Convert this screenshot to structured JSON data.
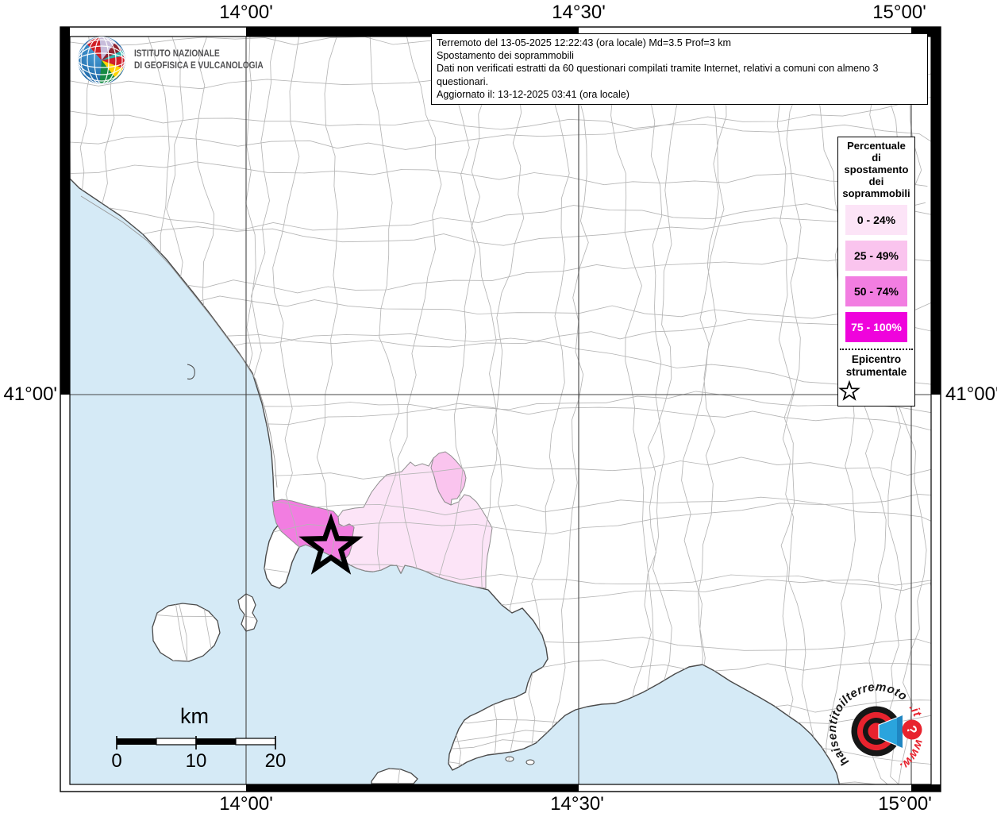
{
  "map_meta": {
    "coords_top": [
      "14°00'",
      "14°30'",
      "15°00'"
    ],
    "coords_bottom": [
      "14°00'",
      "14°30'",
      "15°00'"
    ],
    "coord_left": "41°00'",
    "coord_right": "41°00'"
  },
  "branding": {
    "org_line1": "ISTITUTO NAZIONALE",
    "org_line2": "DI GEOFISICA E VULCANOLOGIA"
  },
  "info_box": {
    "line1": "Terremoto del 13-05-2025 12:22:43 (ora locale) Md=3.5 Prof=3 km",
    "line2": "Spostamento dei soprammobili",
    "line3": "Dati non verificati estratti da 60 questionari compilati tramite Internet, relativi a comuni con almeno 3 questionari.",
    "line4": "Aggiornato il: 13-12-2025 03:41 (ora locale)"
  },
  "legend": {
    "title_line1": "Percentuale",
    "title_line2": "di",
    "title_line3": "spostamento",
    "title_line4": "dei",
    "title_line5": "soprammobili",
    "classes": [
      {
        "label": "0 - 24%",
        "color": "#fce4f7",
        "text": "#000000"
      },
      {
        "label": "25 - 49%",
        "color": "#fac4ee",
        "text": "#000000"
      },
      {
        "label": "50 - 74%",
        "color": "#f27de1",
        "text": "#000000"
      },
      {
        "label": "75 - 100%",
        "color": "#ef03dc",
        "text": "#ffffff"
      }
    ],
    "epicenter_line1": "Epicentro",
    "epicenter_line2": "strumentale"
  },
  "scale_bar": {
    "unit": "km",
    "tick0": "0",
    "tick1": "10",
    "tick2": "20"
  },
  "watermark": {
    "arc_main": "haisentitoilterremoto",
    "arc_suffix": ".it",
    "arc_bottom": "www.",
    "question": "?"
  },
  "map": {
    "sea_color": "#d5eaf6",
    "land_color": "#ffffff",
    "muni_border_color": "#b5b5b5",
    "coast_color": "#4a4a4a",
    "grid_color": "#454545"
  }
}
